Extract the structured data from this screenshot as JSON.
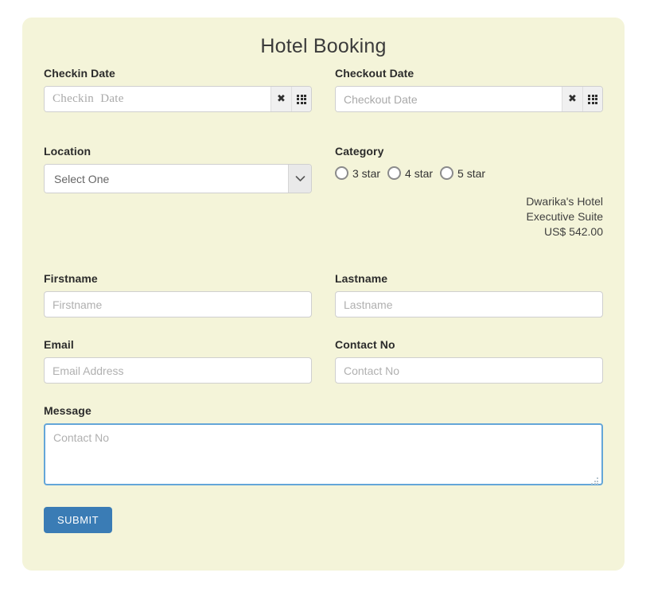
{
  "page": {
    "title": "Hotel Booking",
    "panel_bg": "#f4f4d9",
    "accent": "#3a7cb5",
    "focus_border": "#64a6d8"
  },
  "checkin": {
    "label": "Checkin Date",
    "placeholder": "Checkin  Date",
    "value": "",
    "clear_icon": "clear-x-icon",
    "calendar_icon": "calendar-grid-icon"
  },
  "checkout": {
    "label": "Checkout Date",
    "placeholder": "Checkout Date",
    "value": "",
    "clear_icon": "clear-x-icon",
    "calendar_icon": "calendar-grid-icon"
  },
  "location": {
    "label": "Location",
    "selected": "Select One",
    "arrow_icon": "chevron-down-icon"
  },
  "category": {
    "label": "Category",
    "options": [
      {
        "label": "3 star",
        "checked": false
      },
      {
        "label": "4 star",
        "checked": false
      },
      {
        "label": "5 star",
        "checked": false
      }
    ]
  },
  "summary": {
    "hotel": "Dwarika's Hotel",
    "room": "Executive Suite",
    "price": "US$ 542.00"
  },
  "firstname": {
    "label": "Firstname",
    "placeholder": "Firstname",
    "value": ""
  },
  "lastname": {
    "label": "Lastname",
    "placeholder": "Lastname",
    "value": ""
  },
  "email": {
    "label": "Email",
    "placeholder": "Email Address",
    "value": ""
  },
  "contact": {
    "label": "Contact No",
    "placeholder": "Contact No",
    "value": ""
  },
  "message": {
    "label": "Message",
    "placeholder": "Contact No",
    "value": ""
  },
  "submit": {
    "label": "SUBMIT"
  }
}
